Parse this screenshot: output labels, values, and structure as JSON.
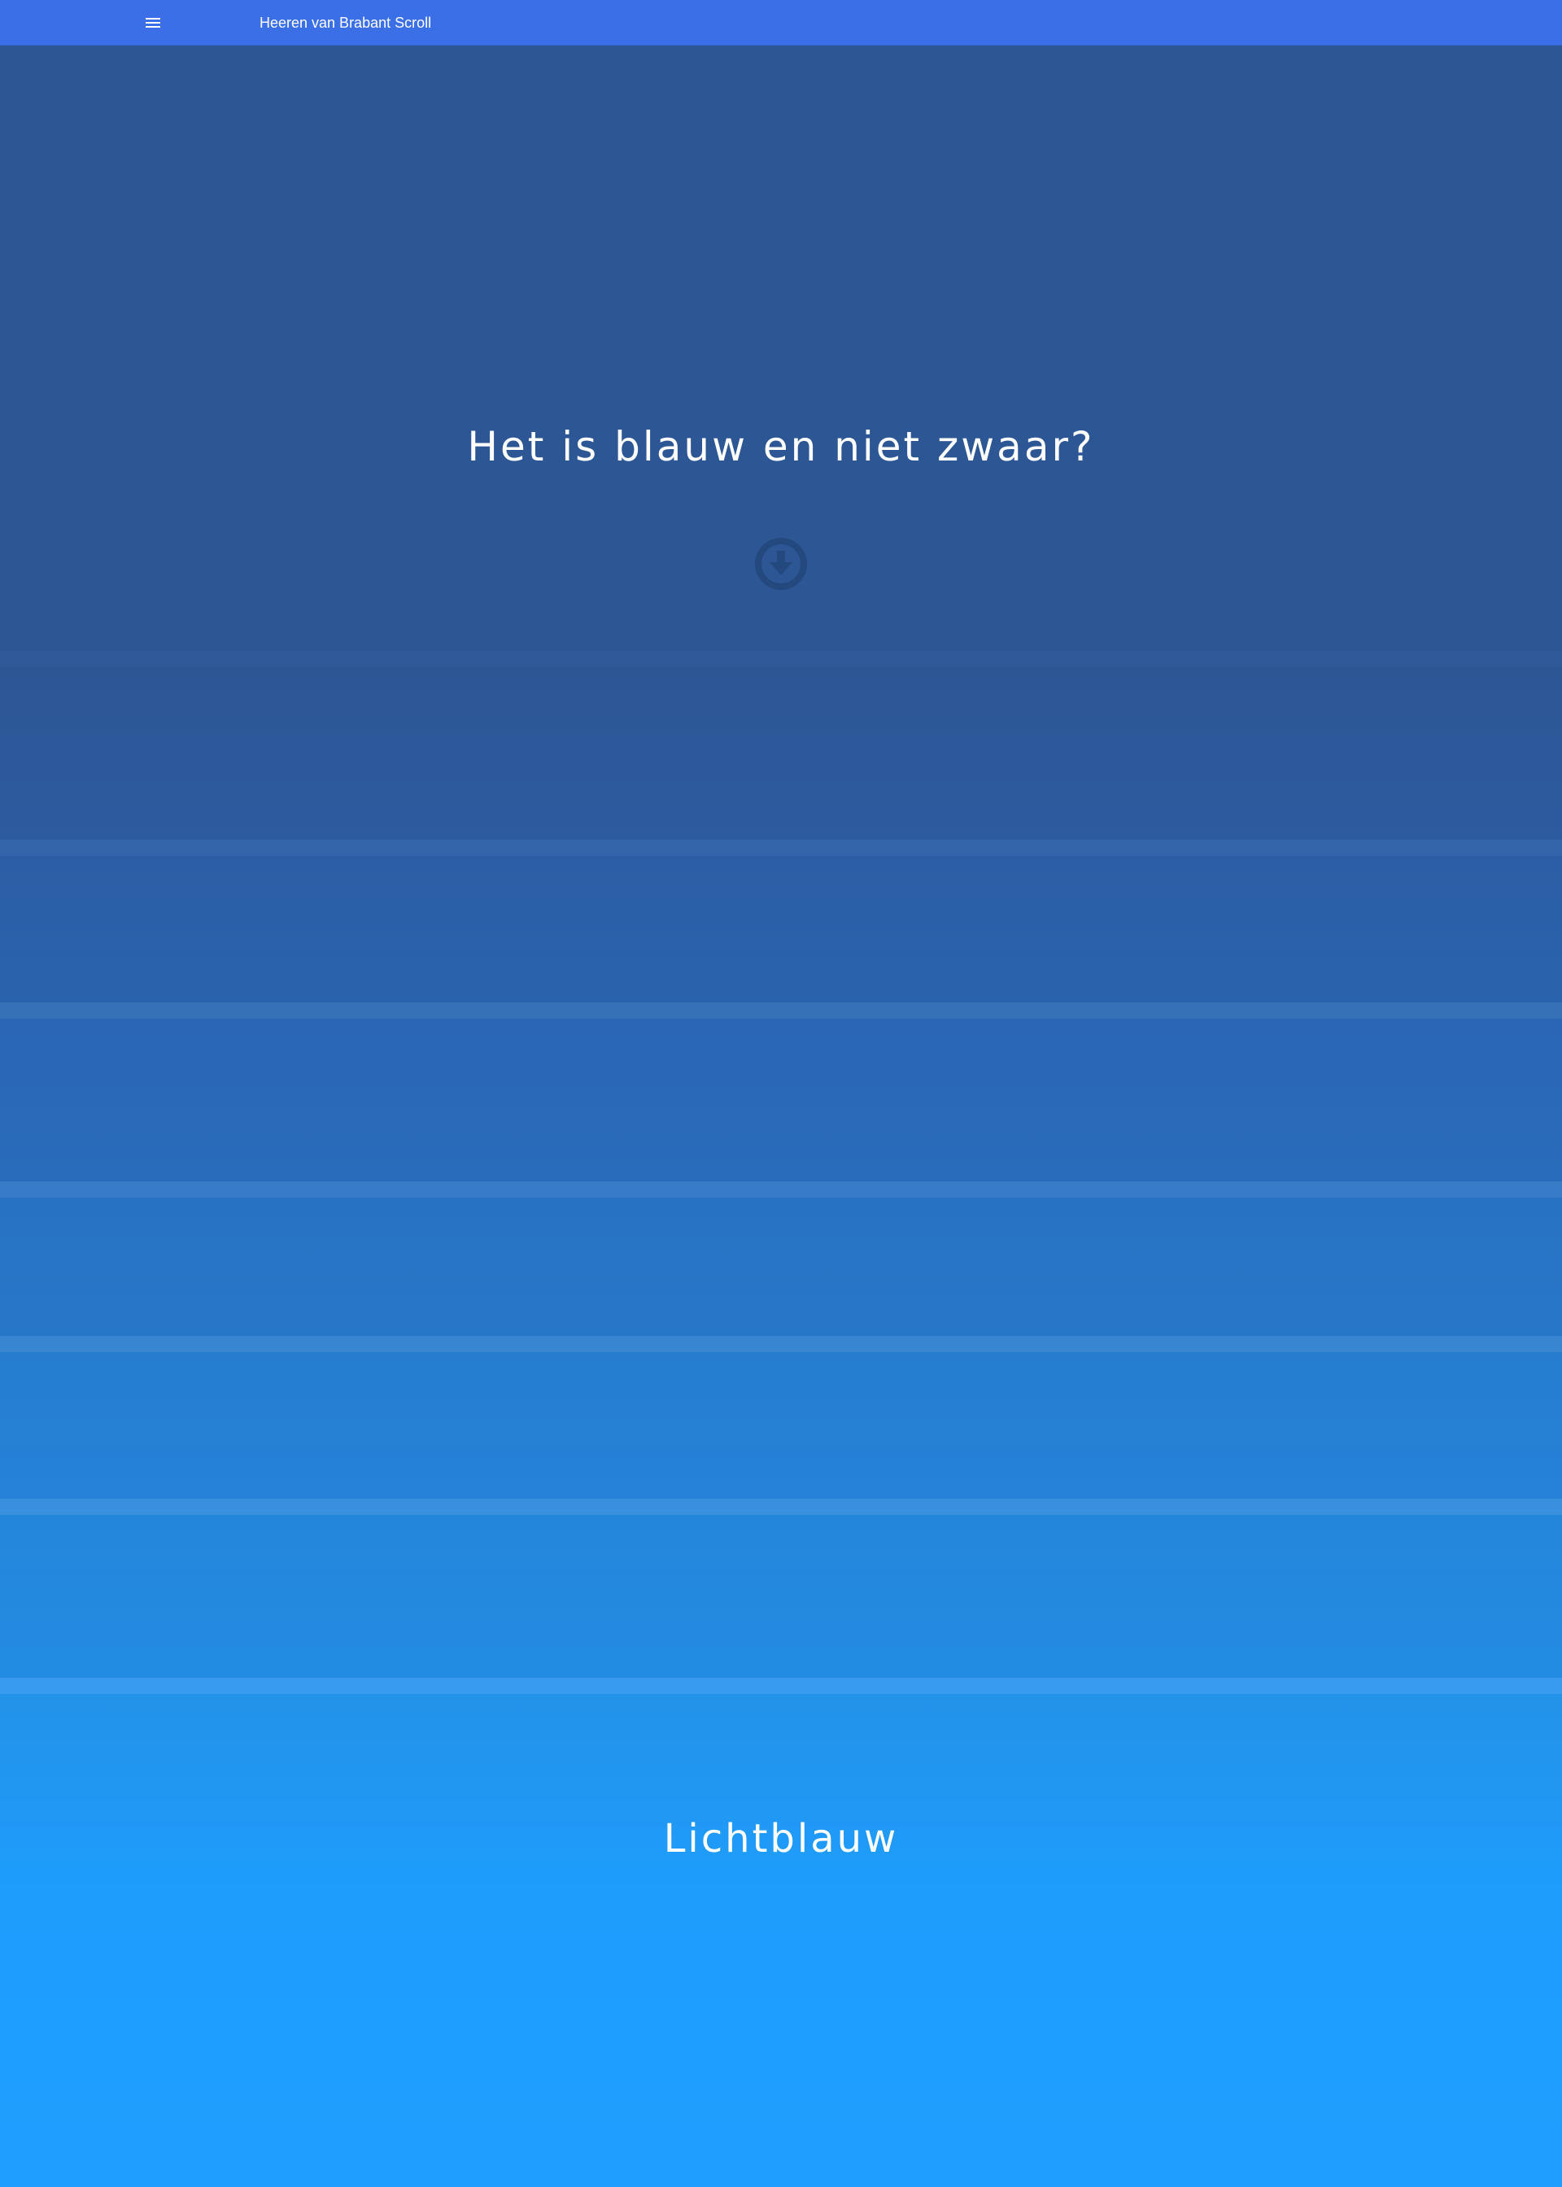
{
  "header": {
    "title": "Heeren van Brabant Scroll",
    "menu_icon": "menu-icon"
  },
  "hero": {
    "title": "Het is blauw en niet zwaar?",
    "scroll_icon": "arrow-down-circle-icon"
  },
  "final_section": {
    "title": "Lichtblauw"
  },
  "colors": {
    "topbar": "#3a6fe8",
    "hero_background": "#2d5695",
    "band_1": "#2d5797",
    "band_2": "#2a61a9",
    "band_3": "#296bb9",
    "band_4": "#2875c6",
    "band_5": "#267ed2",
    "band_6": "#2487dc",
    "band_7": "#2290e6",
    "final_background": "#1f9eff",
    "text": "#ffffff"
  }
}
